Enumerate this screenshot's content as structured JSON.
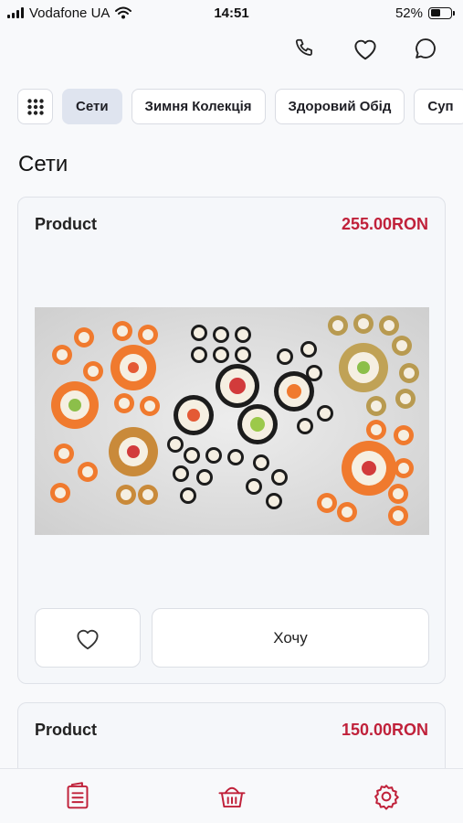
{
  "status_bar": {
    "carrier": "Vodafone UA",
    "time": "14:51",
    "battery": "52%",
    "battery_level": 0.52,
    "icons": [
      "signal-icon",
      "wifi-icon",
      "battery-icon"
    ]
  },
  "header": {
    "actions": [
      "phone-icon",
      "heart-icon",
      "chat-icon"
    ]
  },
  "categories": {
    "grid_icon": "grid-icon",
    "items": [
      {
        "label": "Сети",
        "active": true
      },
      {
        "label": "Зимня Колекція",
        "active": false
      },
      {
        "label": "Здоровий Обід",
        "active": false
      },
      {
        "label": "Суп",
        "active": false
      }
    ]
  },
  "section": {
    "title": "Сети"
  },
  "products": [
    {
      "name": "Product",
      "price": "255.00RON",
      "favorite_icon": "heart-icon",
      "action_label": "Хочу"
    },
    {
      "name": "Product",
      "price": "150.00RON"
    }
  ],
  "colors": {
    "accent": "#c0213a",
    "active_chip": "#dfe4ef",
    "background": "#f8f9fb"
  },
  "bottom_nav": {
    "items": [
      "menu-list-icon",
      "basket-icon",
      "settings-icon"
    ]
  }
}
